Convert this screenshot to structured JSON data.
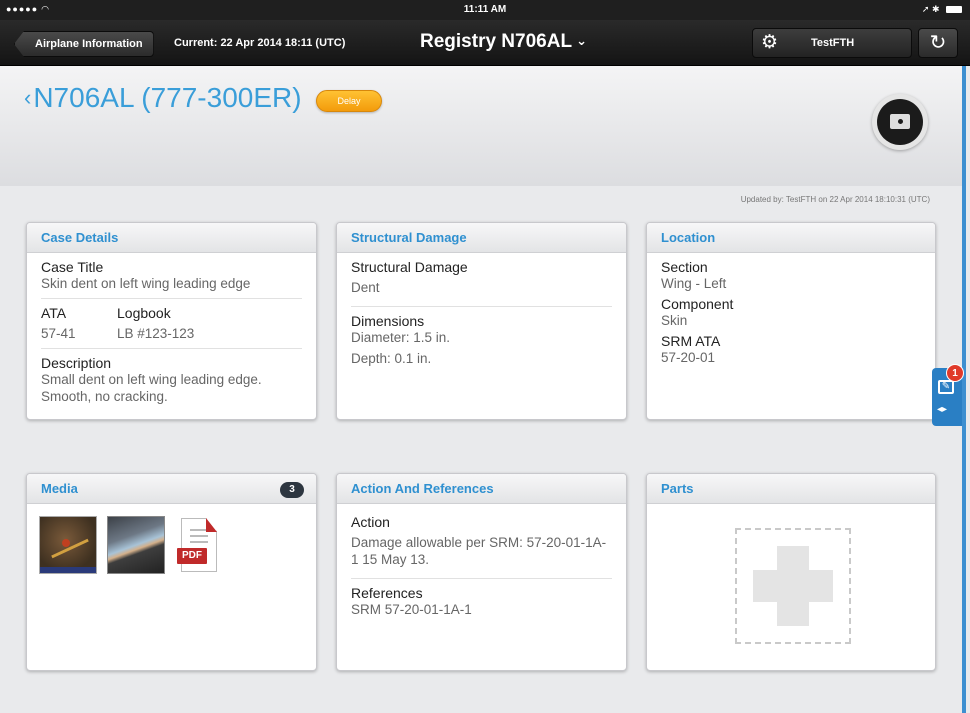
{
  "status": {
    "time": "11:11 AM"
  },
  "nav": {
    "back_label": "Airplane Information",
    "current": "Current: 22 Apr 2014 18:11 (UTC)",
    "registry": "Registry N706AL",
    "user": "TestFTH"
  },
  "header": {
    "title": "N706AL (777-300ER)",
    "badge": "Delay",
    "updated": "Updated by:  TestFTH  on 22 Apr 2014 18:10:31 (UTC)"
  },
  "case_details": {
    "heading": "Case Details",
    "case_title_label": "Case Title",
    "case_title_value": "Skin dent on left wing leading edge",
    "ata_label": "ATA",
    "ata_value": "57-41",
    "logbook_label": "Logbook",
    "logbook_value": "LB #123-123",
    "description_label": "Description",
    "description_value": "Small dent on left wing leading edge. Smooth, no cracking."
  },
  "structural_damage": {
    "heading": "Structural Damage",
    "damage_label": "Structural Damage",
    "damage_value": "Dent",
    "dimensions_label": "Dimensions",
    "diameter": "Diameter: 1.5 in.",
    "depth": "Depth: 0.1 in."
  },
  "location": {
    "heading": "Location",
    "section_label": "Section",
    "section_value": "Wing - Left",
    "component_label": "Component",
    "component_value": "Skin",
    "srm_label": "SRM ATA",
    "srm_value": "57-20-01"
  },
  "media": {
    "heading": "Media",
    "count": "3",
    "pdf_label": "PDF"
  },
  "actions": {
    "heading": "Action And References",
    "action_label": "Action",
    "action_value": "Damage allowable per  SRM: 57-20-01-1A-1 15 May 13.",
    "references_label": "References",
    "references_value": "SRM 57-20-01-1A-1"
  },
  "parts": {
    "heading": "Parts"
  },
  "side": {
    "notification_count": "1"
  },
  "colors": {
    "accent": "#2f90d0",
    "delay": "#f39b0b",
    "badge_red": "#e03a2a"
  }
}
